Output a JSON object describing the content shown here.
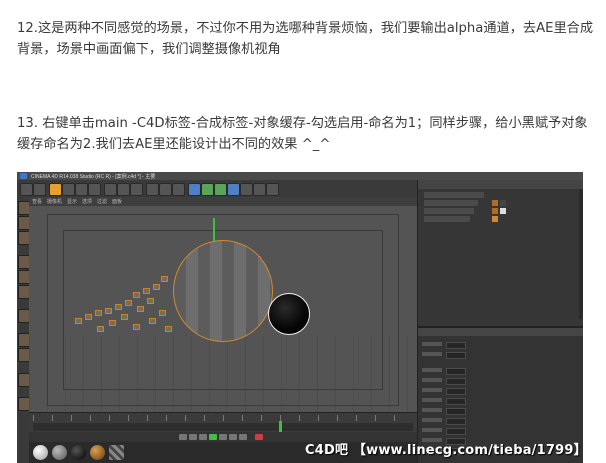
{
  "article": {
    "step12": "12.这是两种不同感觉的场景，不过你不用为选哪种背景烦恼，我们要输出alpha通道，去AE里合成背景，场景中画面偏下，我们调整摄像机视角",
    "step13": "13. 右键单击main -C4D标签-合成标签-对象缓存-勾选启用-命名为1；同样步骤，给小黑赋予对象缓存命名为2.我们去AE里还能设计出不同的效果 ^_^"
  },
  "screenshot": {
    "window_title": "CINEMA 4D R14.038 Studio (RC R) - [案例.c4d *] - 主要",
    "watermark": "C4D吧 【www.linecg.com/tieba/1799】",
    "viewport_menu": [
      "查看",
      "摄像机",
      "显示",
      "选项",
      "过滤",
      "面板"
    ],
    "colors": {
      "selection_orange": "#d08a30",
      "axis_y_green": "#3ec23e",
      "axis_x_red": "#d94848",
      "ui_dark": "#363636"
    }
  }
}
